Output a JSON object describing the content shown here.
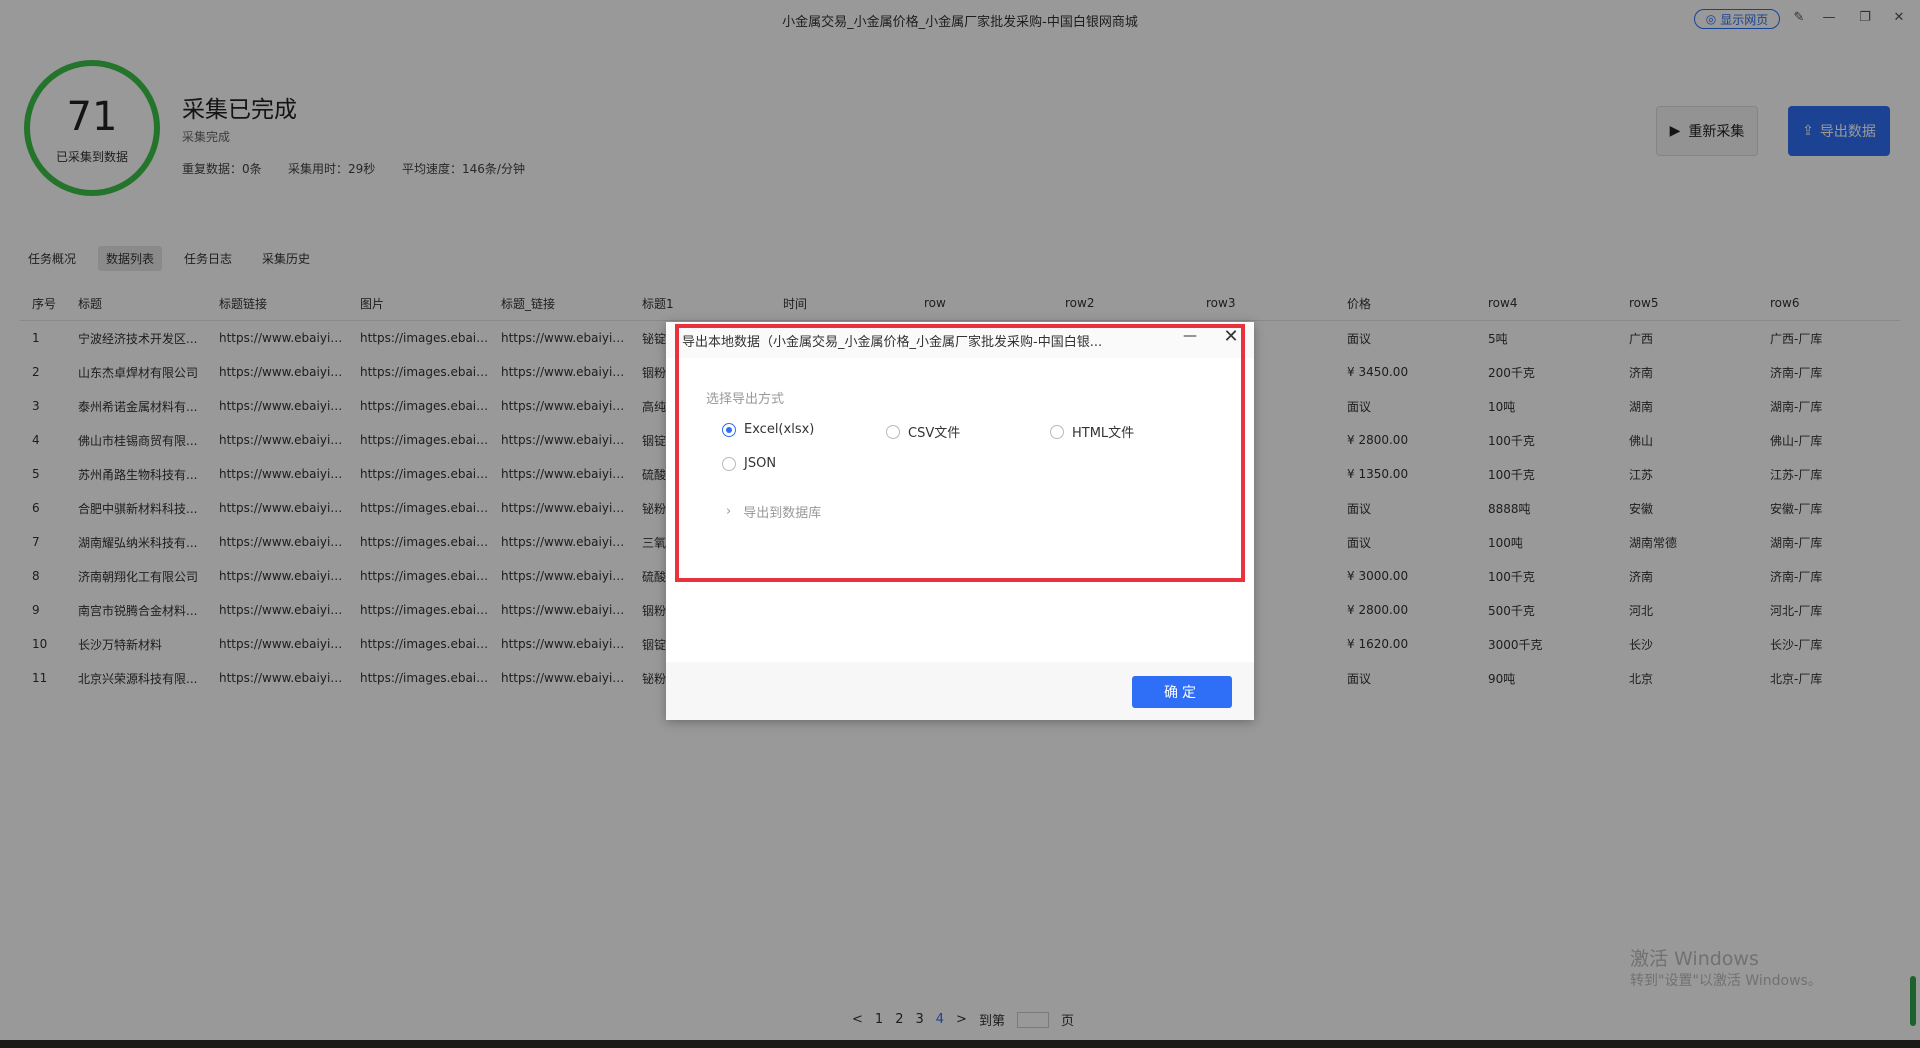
{
  "window": {
    "title": "小金属交易_小金属价格_小金属厂家批发采购-中国白银网商城",
    "show_web_label": "显示网页"
  },
  "summary": {
    "count": "71",
    "count_label": "已采集到数据",
    "title": "采集已完成",
    "subtitle": "采集完成",
    "stats": [
      "重复数据：0条",
      "采集用时：29秒",
      "平均速度：146条/分钟"
    ],
    "restart_label": "重新采集",
    "export_label": "导出数据"
  },
  "tabs": [
    {
      "label": "任务概况",
      "active": false
    },
    {
      "label": "数据列表",
      "active": true
    },
    {
      "label": "任务日志",
      "active": false
    },
    {
      "label": "采集历史",
      "active": false
    }
  ],
  "table": {
    "headers": [
      "序号",
      "标题",
      "标题链接",
      "图片",
      "标题_链接",
      "标题1",
      "时间",
      "row",
      "row2",
      "row3",
      "价格",
      "row4",
      "row5",
      "row6"
    ],
    "rows": [
      [
        "1",
        "宁波经济技术开发区...",
        "https://www.ebaiyin...",
        "https://images.ebaiyi...",
        "https://www.ebaiyin...",
        "铋锭",
        "",
        "",
        "",
        "",
        "面议",
        "5吨",
        "广西",
        "广西-厂库"
      ],
      [
        "2",
        "山东杰卓焊材有限公司",
        "https://www.ebaiyin...",
        "https://images.ebaiyi...",
        "https://www.ebaiyin...",
        "铟粉",
        "",
        "",
        "",
        "",
        "¥ 3450.00",
        "200千克",
        "济南",
        "济南-厂库"
      ],
      [
        "3",
        "泰州希诺金属材料有...",
        "https://www.ebaiyin...",
        "https://images.ebaiyi...",
        "https://www.ebaiyin...",
        "高纯",
        "",
        "",
        "",
        "",
        "面议",
        "10吨",
        "湖南",
        "湖南-厂库"
      ],
      [
        "4",
        "佛山市桂锡商贸有限...",
        "https://www.ebaiyin...",
        "https://images.ebaiyi...",
        "https://www.ebaiyin...",
        "铟锭",
        "",
        "",
        "",
        "",
        "¥ 2800.00",
        "100千克",
        "佛山",
        "佛山-厂库"
      ],
      [
        "5",
        "苏州甬路生物科技有...",
        "https://www.ebaiyin...",
        "https://images.ebaiyi...",
        "https://www.ebaiyin...",
        "硫酸",
        "",
        "",
        "",
        "",
        "¥ 1350.00",
        "100千克",
        "江苏",
        "江苏-厂库"
      ],
      [
        "6",
        "合肥中骐新材料科技...",
        "https://www.ebaiyin...",
        "https://images.ebaiyi...",
        "https://www.ebaiyin...",
        "铋粉",
        "",
        "",
        "",
        "",
        "面议",
        "8888吨",
        "安徽",
        "安徽-厂库"
      ],
      [
        "7",
        "湖南耀弘纳米科技有...",
        "https://www.ebaiyin...",
        "https://images.ebaiyi...",
        "https://www.ebaiyin...",
        "三氧",
        "",
        "",
        "",
        "",
        "面议",
        "100吨",
        "湖南常德",
        "湖南-厂库"
      ],
      [
        "8",
        "济南朝翔化工有限公司",
        "https://www.ebaiyin...",
        "https://images.ebaiyi...",
        "https://www.ebaiyin...",
        "硫酸",
        "",
        "",
        "",
        "",
        "¥ 3000.00",
        "100千克",
        "济南",
        "济南-厂库"
      ],
      [
        "9",
        "南宫市锐腾合金材料...",
        "https://www.ebaiyin...",
        "https://images.ebaiyi...",
        "https://www.ebaiyin...",
        "铟粉",
        "",
        "",
        "",
        "",
        "¥ 2800.00",
        "500千克",
        "河北",
        "河北-厂库"
      ],
      [
        "10",
        "长沙万特新材料",
        "https://www.ebaiyin...",
        "https://images.ebaiyi...",
        "https://www.ebaiyin...",
        "铟锭",
        "",
        "",
        "",
        "",
        "¥ 1620.00",
        "3000千克",
        "长沙",
        "长沙-厂库"
      ],
      [
        "11",
        "北京兴荣源科技有限...",
        "https://www.ebaiyin...",
        "https://images.ebaiyi...",
        "https://www.ebaiyin...",
        "铋粉",
        "",
        "",
        "",
        "",
        "面议",
        "90吨",
        "北京",
        "北京-厂库"
      ]
    ]
  },
  "pager": {
    "prev": "<",
    "pages": [
      "1",
      "2",
      "3",
      "4"
    ],
    "current": "4",
    "next": ">",
    "goto_prefix": "到第",
    "goto_suffix": "页"
  },
  "watermark": {
    "line1": "激活 Windows",
    "line2": "转到\"设置\"以激活 Windows。"
  },
  "modal": {
    "title": "导出本地数据（小金属交易_小金属价格_小金属厂家批发采购-中国白银...",
    "section_label": "选择导出方式",
    "options": [
      {
        "label": "Excel(xlsx)",
        "selected": true
      },
      {
        "label": "CSV文件",
        "selected": false
      },
      {
        "label": "HTML文件",
        "selected": false
      },
      {
        "label": "JSON",
        "selected": false
      }
    ],
    "db_label": "导出到数据库",
    "ok_label": "确定"
  },
  "colors": {
    "accent": "#2f6ef6",
    "ring": "#3cc24a",
    "highlight": "#e8323c"
  }
}
